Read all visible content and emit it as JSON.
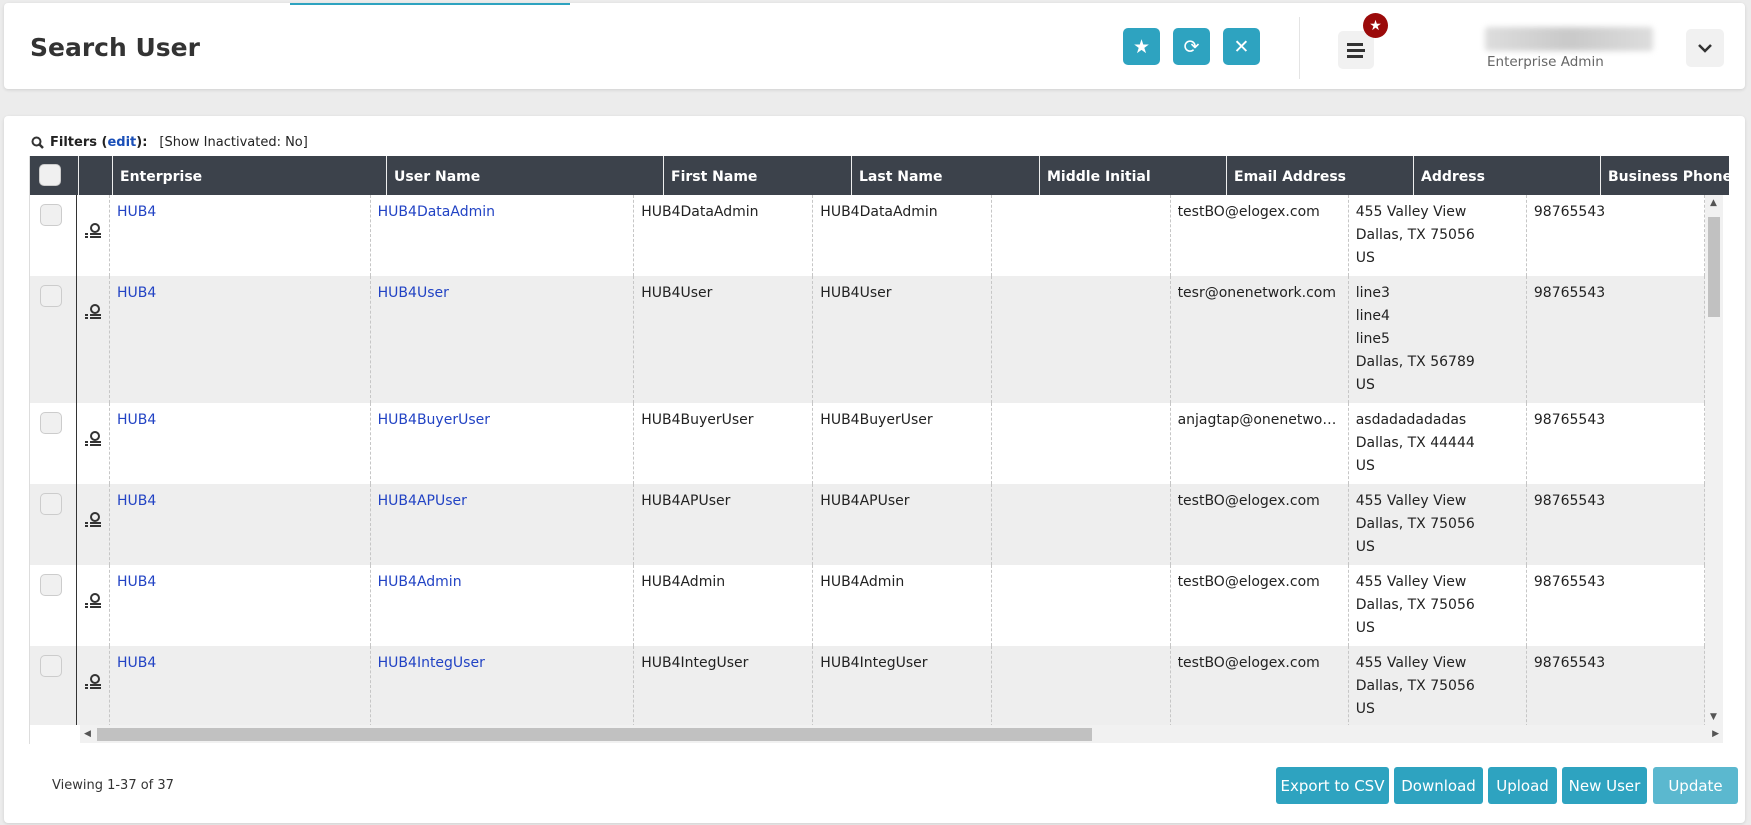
{
  "header": {
    "title": "Search User",
    "favorite_icon": "star-icon",
    "refresh_icon": "refresh-icon",
    "close_icon": "close-icon",
    "menu_icon": "menu-icon",
    "badge_icon": "star-icon",
    "user_role": "Enterprise Admin"
  },
  "filters": {
    "label": "Filters (",
    "edit": "edit",
    "label_end": "):",
    "summary": "[Show Inactivated: No]"
  },
  "table": {
    "columns": [
      "",
      "",
      "Enterprise",
      "User Name",
      "First Name",
      "Last Name",
      "Middle Initial",
      "Email Address",
      "Address",
      "Business Phone"
    ],
    "rows": [
      {
        "enterprise": "HUB4",
        "user_name": "HUB4DataAdmin",
        "first_name": "HUB4DataAdmin",
        "last_name": "HUB4DataAdmin",
        "middle_initial": "",
        "email": "testBO@elogex.com",
        "address": [
          "455 Valley View",
          "Dallas, TX 75056",
          "US"
        ],
        "phone": "98765543"
      },
      {
        "enterprise": "HUB4",
        "user_name": "HUB4User",
        "first_name": "HUB4User",
        "last_name": "HUB4User",
        "middle_initial": "",
        "email": "tesr@onenetwork.com",
        "address": [
          "line3",
          "line4",
          "line5",
          "Dallas, TX 56789",
          "US"
        ],
        "phone": "98765543"
      },
      {
        "enterprise": "HUB4",
        "user_name": "HUB4BuyerUser",
        "first_name": "HUB4BuyerUser",
        "last_name": "HUB4BuyerUser",
        "middle_initial": "",
        "email": "anjagtap@onenetwork.c...",
        "address": [
          "asdadadadadas",
          "Dallas, TX 44444",
          "US"
        ],
        "phone": "98765543"
      },
      {
        "enterprise": "HUB4",
        "user_name": "HUB4APUser",
        "first_name": "HUB4APUser",
        "last_name": "HUB4APUser",
        "middle_initial": "",
        "email": "testBO@elogex.com",
        "address": [
          "455 Valley View",
          "Dallas, TX 75056",
          "US"
        ],
        "phone": "98765543"
      },
      {
        "enterprise": "HUB4",
        "user_name": "HUB4Admin",
        "first_name": "HUB4Admin",
        "last_name": "HUB4Admin",
        "middle_initial": "",
        "email": "testBO@elogex.com",
        "address": [
          "455 Valley View",
          "Dallas, TX 75056",
          "US"
        ],
        "phone": "98765543"
      },
      {
        "enterprise": "HUB4",
        "user_name": "HUB4IntegUser",
        "first_name": "HUB4IntegUser",
        "last_name": "HUB4IntegUser",
        "middle_initial": "",
        "email": "testBO@elogex.com",
        "address": [
          "455 Valley View",
          "Dallas, TX 75056",
          "US"
        ],
        "phone": "98765543"
      }
    ]
  },
  "footer": {
    "viewing": "Viewing 1-37 of 37",
    "buttons": [
      "Export to CSV",
      "Download",
      "Upload",
      "New User",
      "Update"
    ]
  },
  "colors": {
    "accent": "#2ea3c0",
    "header_bg": "#3c424b",
    "badge": "#9b0a0a",
    "link": "#2243c4"
  }
}
